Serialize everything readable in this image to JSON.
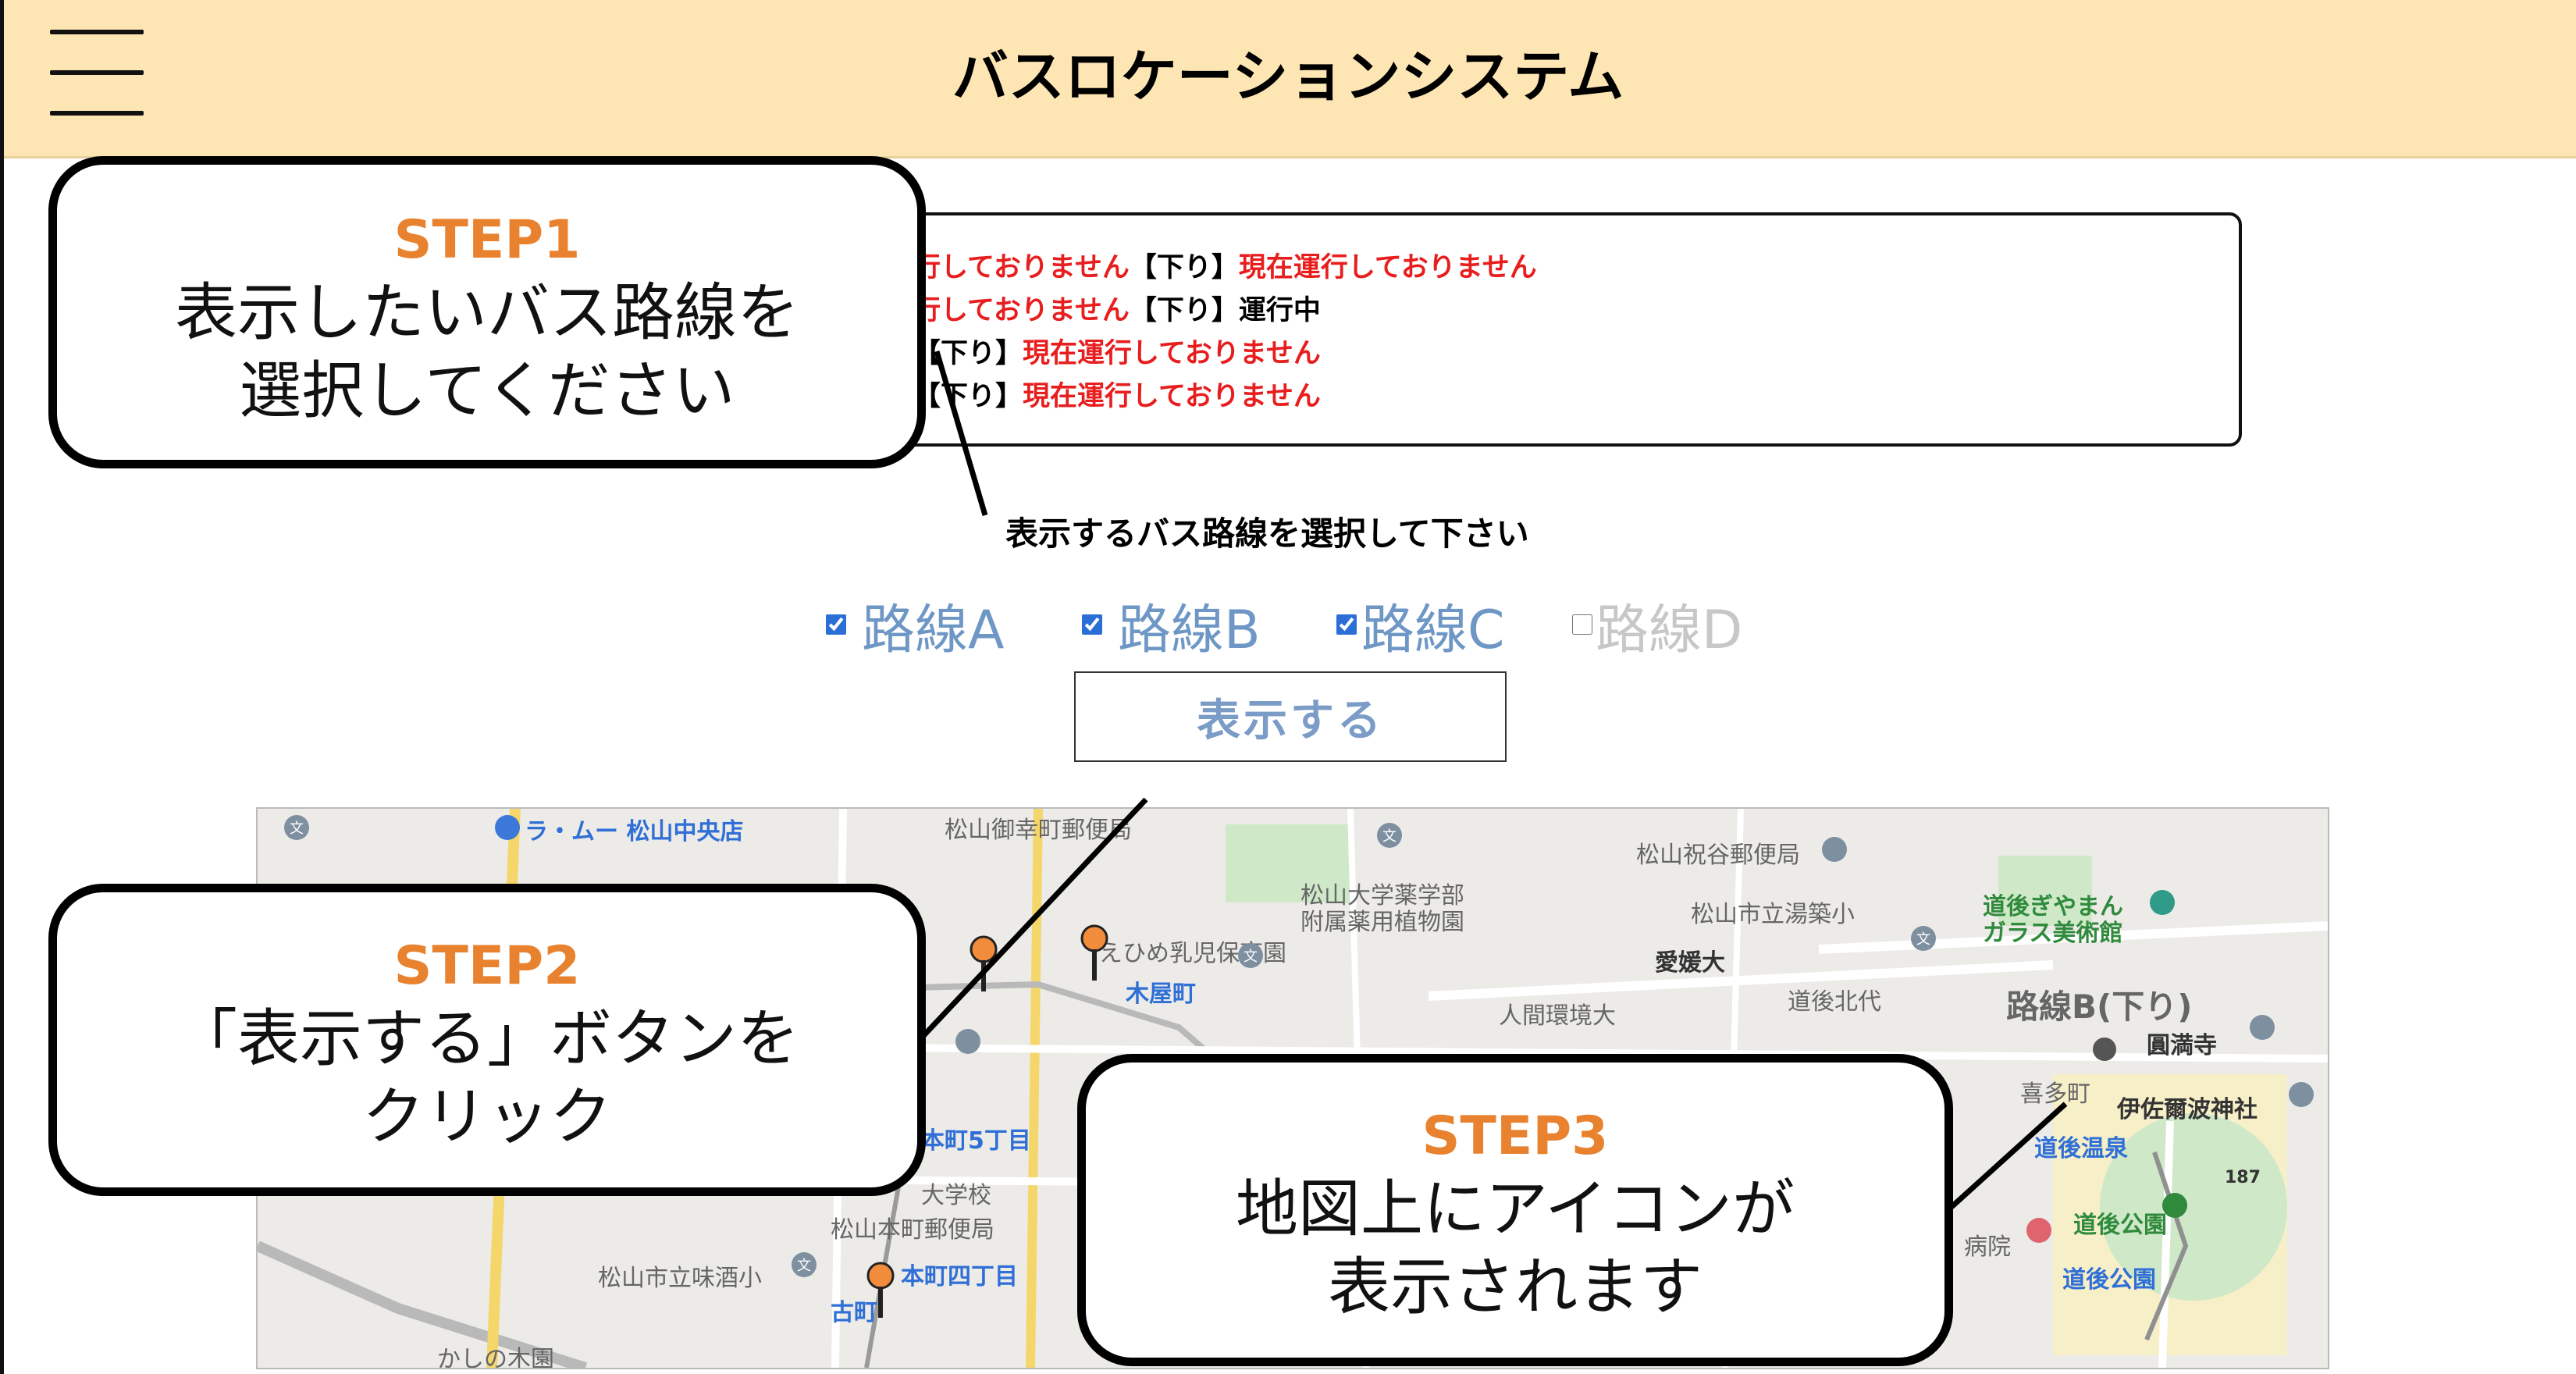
{
  "header": {
    "title": "バスロケーションシステム"
  },
  "status": {
    "lines": [
      {
        "a": "行しておりません",
        "dir": "【下り】",
        "b": "現在運行しておりません",
        "b_running": false
      },
      {
        "a": "行しておりません",
        "dir": "【下り】",
        "b": "運行中",
        "b_running": true
      },
      {
        "a": "",
        "dir": "【下り】",
        "b": "現在運行しておりません",
        "b_running": false
      },
      {
        "a": "",
        "dir": "【下り】",
        "b": "現在運行しておりません",
        "b_running": false
      }
    ]
  },
  "selector": {
    "prompt": "表示するバス路線を選択して下さい",
    "routes": [
      {
        "label": "路線A",
        "checked": true
      },
      {
        "label": "路線B",
        "checked": true
      },
      {
        "label": "路線C",
        "checked": true
      },
      {
        "label": "路線D",
        "checked": false
      }
    ],
    "button_label": "表示する"
  },
  "map": {
    "labels": [
      {
        "text": "ラ・ムー 松山中央店",
        "style": "blue"
      },
      {
        "text": "松山御幸町郵便局",
        "style": "gray"
      },
      {
        "text": "松山祝谷郵便局",
        "style": "gray"
      },
      {
        "text": "松山大学薬学部",
        "style": "gray"
      },
      {
        "text": "附属薬用植物園",
        "style": "gray"
      },
      {
        "text": "松山市立湯築小",
        "style": "gray"
      },
      {
        "text": "道後ぎやまん",
        "style": "green"
      },
      {
        "text": "ガラス美術館",
        "style": "green"
      },
      {
        "text": "えひめ乳児保育園",
        "style": "gray"
      },
      {
        "text": "木屋町",
        "style": "blue"
      },
      {
        "text": "愛媛大",
        "style": "dark"
      },
      {
        "text": "人間環境大",
        "style": "gray"
      },
      {
        "text": "道後北代",
        "style": "gray"
      },
      {
        "text": "圓満寺",
        "style": "dark"
      },
      {
        "text": "伊佐爾波神社",
        "style": "dark"
      },
      {
        "text": "道後温泉",
        "style": "blue"
      },
      {
        "text": "本町5丁目",
        "style": "blue"
      },
      {
        "text": "松山本町郵便局",
        "style": "gray"
      },
      {
        "text": "松山市立味酒小",
        "style": "gray"
      },
      {
        "text": "本町四丁目",
        "style": "blue"
      },
      {
        "text": "古町",
        "style": "blue"
      },
      {
        "text": "かしの木園",
        "style": "gray"
      },
      {
        "text": "道後公園",
        "style": "green"
      },
      {
        "text": "道後公園",
        "style": "blue"
      },
      {
        "text": "病院",
        "style": "gray"
      },
      {
        "text": "187",
        "style": "dark"
      },
      {
        "text": "喜多町",
        "style": "gray"
      },
      {
        "text": "大学校",
        "style": "gray"
      }
    ],
    "route_overlay": "路線B(下り)"
  },
  "callouts": {
    "step1": {
      "step": "STEP1",
      "text": "表示したいバス路線を\n選択してください"
    },
    "step2": {
      "step": "STEP2",
      "text": "「表示する」ボタンを\nクリック"
    },
    "step3": {
      "step": "STEP3",
      "text": "地図上にアイコンが\n表示されます"
    }
  },
  "colors": {
    "header_bg": "#fde6b3",
    "step_orange": "#e8822f",
    "status_red": "#e81e1e",
    "route_blue": "#6f97c5",
    "route_off": "#c7c7c7"
  }
}
